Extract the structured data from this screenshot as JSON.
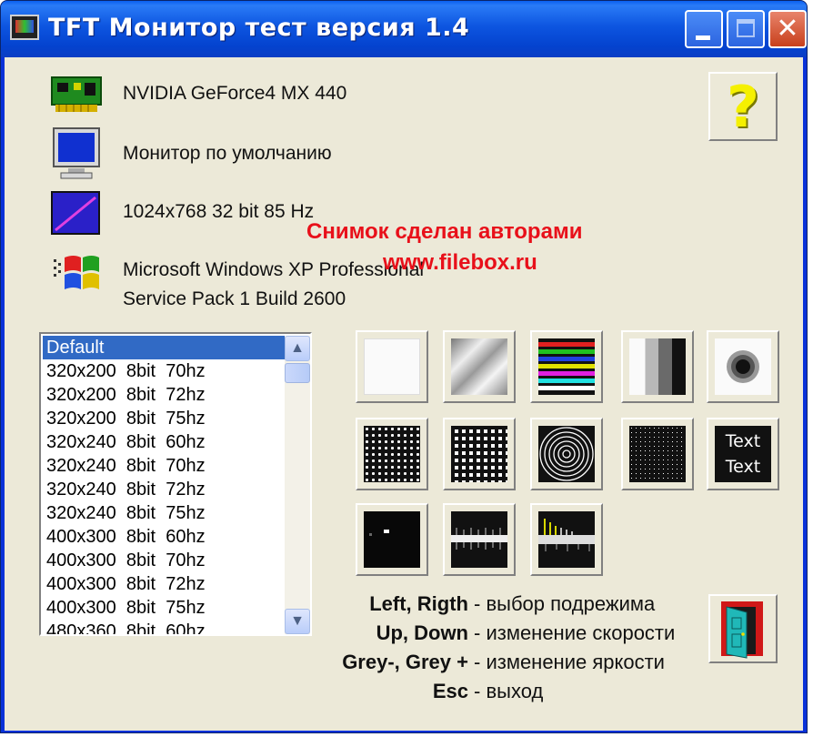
{
  "window": {
    "title": "TFT Монитор тест версия 1.4",
    "controls": {
      "minimize": "minimize",
      "maximize": "maximize",
      "close": "close"
    }
  },
  "system_info": {
    "video_card": "NVIDIA GeForce4 MX 440",
    "monitor": "Монитор по умолчанию",
    "display_mode": "1024x768 32 bit 85 Hz",
    "os_line1": "Microsoft Windows XP Professional",
    "os_line2": "Service Pack 1 Build 2600"
  },
  "watermark": {
    "line1": "Снимок сделан авторами",
    "line2": "www.filebox.ru"
  },
  "modes_list": {
    "selected": "Default",
    "items": [
      "Default",
      "320x200  8bit  70hz",
      "320x200  8bit  72hz",
      "320x200  8bit  75hz",
      "320x240  8bit  60hz",
      "320x240  8bit  70hz",
      "320x240  8bit  72hz",
      "320x240  8bit  75hz",
      "400x300  8bit  60hz",
      "400x300  8bit  70hz",
      "400x300  8bit  72hz",
      "400x300  8bit  75hz",
      "480x360  8bit  60hz"
    ]
  },
  "test_tiles": {
    "text_tile_line1": "Text",
    "text_tile_line2": "Text"
  },
  "keys": [
    {
      "key": "Left, Rigth",
      "desc": "- выбор подрежима"
    },
    {
      "key": "Up, Down",
      "desc": "- изменение скорости"
    },
    {
      "key": "Grey-, Grey +",
      "desc": "- изменение яркости"
    },
    {
      "key": "Esc",
      "desc": "- выход"
    }
  ],
  "help_button": {
    "label": "?"
  },
  "colors": {
    "title_bar": "#0a55e0",
    "selection": "#316ac5",
    "watermark": "#e8101a",
    "face": "#ece9d8"
  },
  "icons": [
    "video-card-icon",
    "monitor-icon",
    "display-mode-icon",
    "windows-logo-icon",
    "help-icon",
    "exit-door-icon"
  ]
}
